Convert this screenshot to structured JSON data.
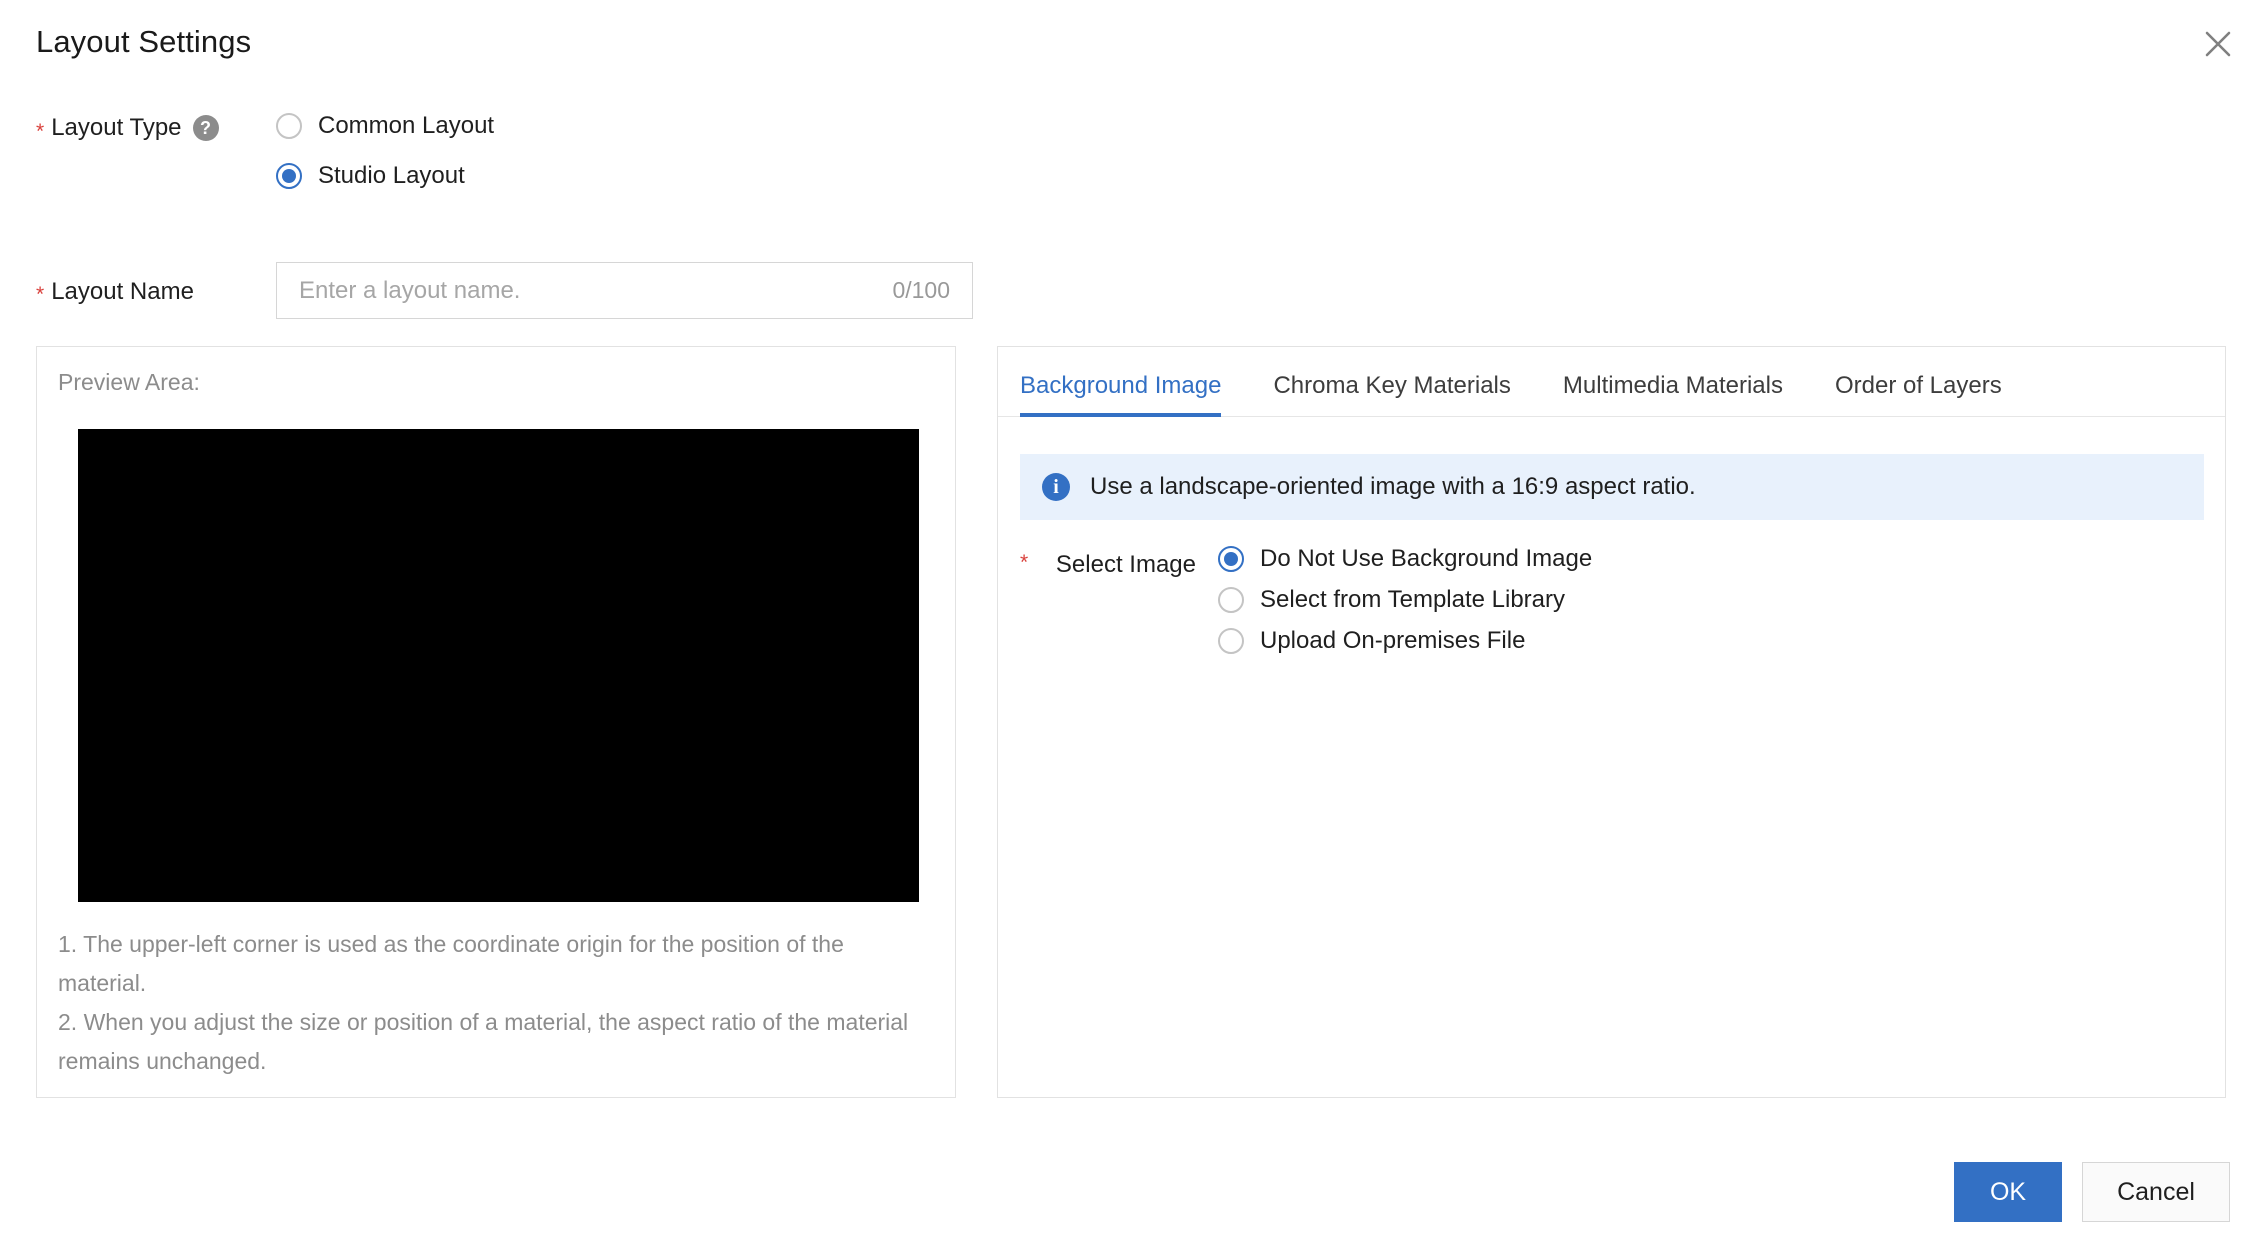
{
  "dialog": {
    "title": "Layout Settings",
    "close_icon": "close-icon"
  },
  "layout_type": {
    "label": "Layout Type",
    "required_marker": "*",
    "help_icon": "?",
    "options": [
      {
        "label": "Common Layout",
        "checked": false
      },
      {
        "label": "Studio Layout",
        "checked": true
      }
    ]
  },
  "layout_name": {
    "label": "Layout Name",
    "required_marker": "*",
    "placeholder": "Enter a layout name.",
    "value": "",
    "counter": "0/100"
  },
  "preview": {
    "caption": "Preview Area:",
    "notes": "1. The upper-left corner is used as the coordinate origin for the position of the material.\n2. When you adjust the size or position of a material, the aspect ratio of the material remains unchanged."
  },
  "tabs": [
    {
      "label": "Background Image",
      "active": true
    },
    {
      "label": "Chroma Key Materials",
      "active": false
    },
    {
      "label": "Multimedia Materials",
      "active": false
    },
    {
      "label": "Order of Layers",
      "active": false
    }
  ],
  "info_banner": {
    "icon": "info-icon",
    "text": "Use a landscape-oriented image with a 16:9 aspect ratio."
  },
  "select_image": {
    "required_marker": "*",
    "label": "Select Image",
    "options": [
      {
        "label": "Do Not Use Background Image",
        "checked": true
      },
      {
        "label": "Select from Template Library",
        "checked": false
      },
      {
        "label": "Upload On-premises File",
        "checked": false
      }
    ]
  },
  "footer": {
    "ok_label": "OK",
    "cancel_label": "Cancel"
  },
  "colors": {
    "accent": "#3370c4",
    "required": "#d9413c",
    "banner_bg": "#e8f1fc",
    "muted_text": "#8c8c8c"
  }
}
